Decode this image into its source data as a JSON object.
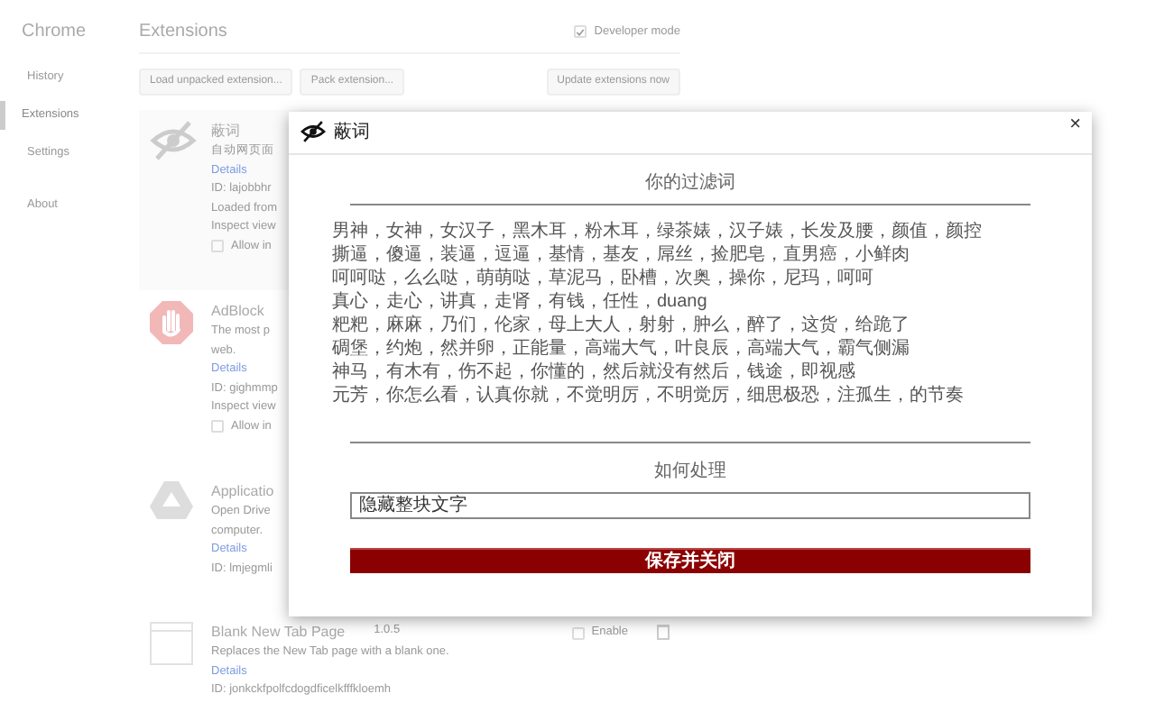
{
  "sidebar": {
    "title": "Chrome",
    "items": [
      {
        "label": "History",
        "selected": false
      },
      {
        "label": "Extensions",
        "selected": true
      },
      {
        "label": "Settings",
        "selected": false
      },
      {
        "label": "About",
        "selected": false
      }
    ]
  },
  "header": {
    "title": "Extensions",
    "developer_mode": {
      "label": "Developer mode",
      "checked": true
    },
    "buttons": [
      "Load unpacked extension...",
      "Pack extension..."
    ],
    "update_button": "Update extensions now"
  },
  "extensions": [
    {
      "kind": "eye",
      "name": "蔽词",
      "description": "自动网页面",
      "link": "Details",
      "lines": [
        "ID: lajobbhr",
        "Loaded from",
        "Inspect view"
      ],
      "allow": {
        "label": "Allow in",
        "checked": false
      }
    },
    {
      "kind": "stop",
      "name": "AdBlock",
      "description": "The most p",
      "description_2": "web.",
      "link": "Details",
      "lines": [
        "ID: gighmmp",
        "Inspect view"
      ],
      "allow": {
        "label": "Allow in",
        "checked": false
      }
    },
    {
      "kind": "drive",
      "name": "Applicatio",
      "description": "Open Drive",
      "description_2": "computer.",
      "link": "Details",
      "lines": [
        "ID: lmjegmli"
      ]
    },
    {
      "kind": "page",
      "name": "Blank New Tab Page",
      "version": "1.0.5",
      "description": "Replaces the New Tab page with a blank one.",
      "link": "Details",
      "lines": [
        "ID: jonkckfpolfcdogdficelkfffkloemh"
      ],
      "enable": {
        "label": "Enable",
        "checked": false
      }
    }
  ],
  "dialog": {
    "title": "蔽词",
    "close": "×",
    "filter_heading": "你的过滤词",
    "filter_lines": [
      "男神，女神，女汉子，黑木耳，粉木耳，绿茶婊，汉子婊，长发及腰，颜值，颜控",
      "撕逼，傻逼，装逼，逗逼，基情，基友，屌丝，捡肥皂，直男癌，小鲜肉",
      "呵呵哒，么么哒，萌萌哒，草泥马，卧槽，次奥，操你，尼玛，呵呵",
      "真心，走心，讲真，走肾，有钱，任性，duang",
      "粑粑，麻麻，乃们，伦家，母上大人，射射，肿么，醉了，这货，给跪了",
      "碉堡，约炮，然并卵，正能量，高端大气，叶良辰，高端大气，霸气侧漏",
      "神马，有木有，伤不起，你懂的，然后就没有然后，钱途，即视感",
      "元芳，你怎么看，认真你就，不觉明厉，不明觉厉，细思极恐，注孤生，的节奏"
    ],
    "action_heading": "如何处理",
    "action_value": "隐藏整块文字",
    "save_button": "保存并关闭"
  }
}
